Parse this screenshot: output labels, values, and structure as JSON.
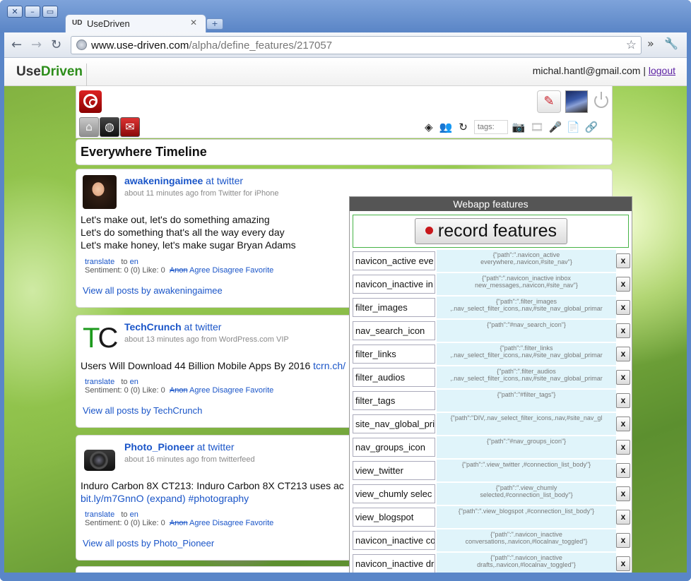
{
  "browser": {
    "tab_title": "UseDriven",
    "tab_favicon": "UD",
    "url_host": "www.use-driven.com",
    "url_path": "/alpha/define_features/217057"
  },
  "site": {
    "logo_use": "Use",
    "logo_driven": "Driven",
    "user_email": "michal.hantl@gmail.com",
    "separator": "|",
    "logout": "logout"
  },
  "filters": {
    "tags_placeholder": "tags:"
  },
  "timeline": {
    "title": "Everywhere Timeline",
    "posts": [
      {
        "author": "awakeningaimee",
        "network": "at twitter",
        "meta": "about 11 minutes ago from Twitter for iPhone",
        "lines": [
          "Let's make out, let's do something amazing",
          "Let's do something that's all the way every day",
          "Let's make honey, let's make sugar Bryan Adams"
        ],
        "translate": "translate",
        "to": "to",
        "lang": "en",
        "sentiment": "Sentiment: 0 (0)",
        "like": "Like: 0",
        "anon": "Anon",
        "agree": "Agree",
        "disagree": "Disagree",
        "favorite": "Favorite",
        "view_all": "View all posts by awakeningaimee"
      },
      {
        "author": "TechCrunch",
        "network": "at twitter",
        "meta": "about 13 minutes ago from WordPress.com VIP",
        "text": "Users Will Download 44 Billion Mobile Apps By 2016 ",
        "link": "tcrn.ch/",
        "translate": "translate",
        "to": "to",
        "lang": "en",
        "sentiment": "Sentiment: 0 (0)",
        "like": "Like: 0",
        "anon": "Anon",
        "agree": "Agree",
        "disagree": "Disagree",
        "favorite": "Favorite",
        "view_all": "View all posts by TechCrunch"
      },
      {
        "author": "Photo_Pioneer",
        "network": "at twitter",
        "meta": "about 16 minutes ago from twitterfeed",
        "text": "Induro Carbon 8X CT213: Induro Carbon 8X CT213 uses ac",
        "link": "bit.ly/m7GnnO (expand) #photography",
        "translate": "translate",
        "to": "to",
        "lang": "en",
        "sentiment": "Sentiment: 0 (0)",
        "like": "Like: 0",
        "anon": "Anon",
        "agree": "Agree",
        "disagree": "Disagree",
        "favorite": "Favorite",
        "view_all": "View all posts by Photo_Pioneer"
      }
    ]
  },
  "features_panel": {
    "title": "Webapp features",
    "record_label": "record features",
    "remove_label": "x",
    "rows": [
      {
        "name": "navicon_active eve",
        "path": "{\"path\":\".navicon_active\neverywhere,.navicon,#site_nav\"}"
      },
      {
        "name": "navicon_inactive in",
        "path": "{\"path\":\".navicon_inactive inbox\nnew_messages,.navicon,#site_nav\"}"
      },
      {
        "name": "filter_images",
        "path": "{\"path\":\".filter_images\n,.nav_select_filter_icons,.nav,#site_nav_global_primar"
      },
      {
        "name": "nav_search_icon",
        "path": "{\"path\":\"#nav_search_icon\"}"
      },
      {
        "name": "filter_links",
        "path": "{\"path\":\".filter_links\n,.nav_select_filter_icons,.nav,#site_nav_global_primar"
      },
      {
        "name": "filter_audios",
        "path": "{\"path\":\".filter_audios\n,.nav_select_filter_icons,.nav,#site_nav_global_primar"
      },
      {
        "name": "filter_tags",
        "path": "{\"path\":\"#filter_tags\"}"
      },
      {
        "name": "site_nav_global_pri",
        "path": "{\"path\":\"DIV,.nav_select_filter_icons,.nav,#site_nav_gl"
      },
      {
        "name": "nav_groups_icon",
        "path": "{\"path\":\"#nav_groups_icon\"}"
      },
      {
        "name": "view_twitter",
        "path": "{\"path\":\".view_twitter ,#connection_list_body\"}"
      },
      {
        "name": "view_chumly selec",
        "path": "{\"path\":\".view_chumly\nselected,#connection_list_body\"}"
      },
      {
        "name": "view_blogspot",
        "path": "{\"path\":\".view_blogspot ,#connection_list_body\"}"
      },
      {
        "name": "navicon_inactive co",
        "path": "{\"path\":\".navicon_inactive\nconversations,.navicon,#localnav_toggled\"}"
      },
      {
        "name": "navicon_inactive dr",
        "path": "{\"path\":\".navicon_inactive\ndrafts,.navicon,#localnav_toggled\"}"
      }
    ]
  }
}
